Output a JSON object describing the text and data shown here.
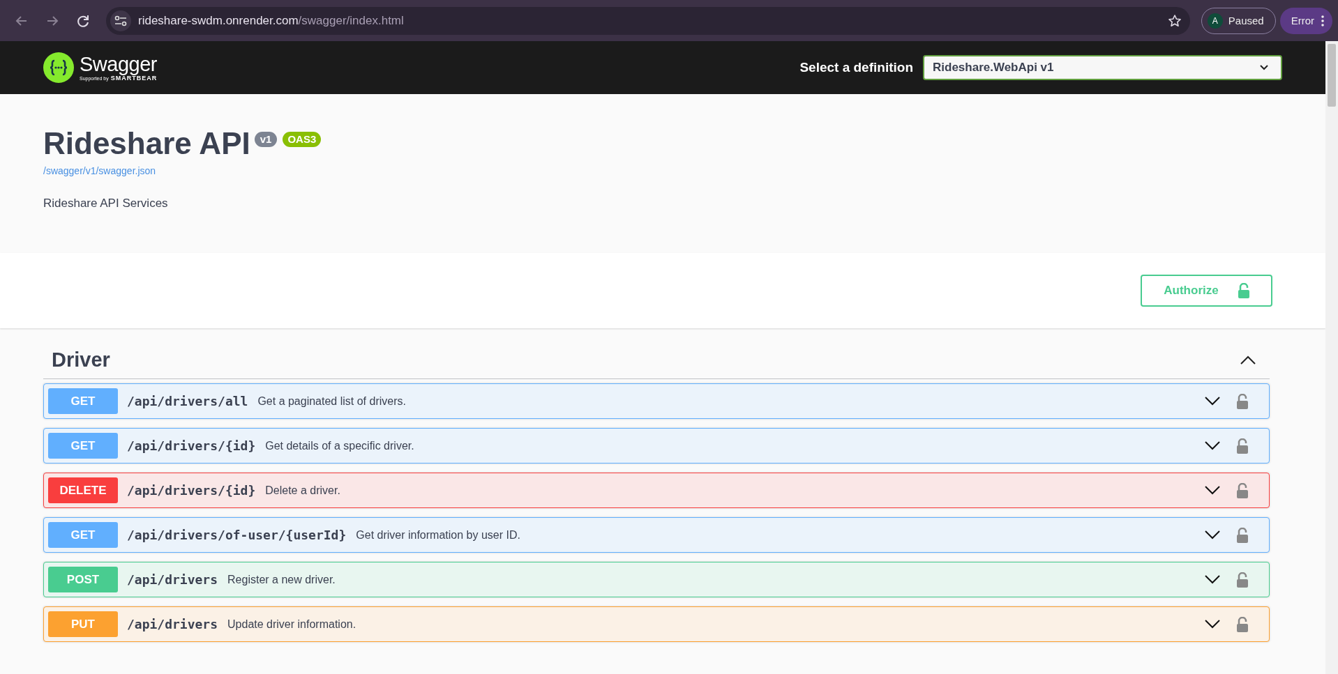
{
  "browser": {
    "url_host": "rideshare-swdm.onrender.com",
    "url_path": "/swagger/index.html",
    "profile": {
      "initial": "A",
      "label": "Paused"
    },
    "error_button": "Error"
  },
  "topbar": {
    "logo_text": "Swagger",
    "logo_sub_prefix": "Supported by",
    "logo_sub_brand": "SMARTBEAR",
    "select_label": "Select a definition",
    "select_value": "Rideshare.WebApi v1"
  },
  "info": {
    "title": "Rideshare API",
    "version": "v1",
    "oas": "OAS3",
    "spec_link": "/swagger/v1/swagger.json",
    "description": "Rideshare API Services"
  },
  "authorize": {
    "label": "Authorize"
  },
  "tags": [
    {
      "name": "Driver",
      "expanded": true,
      "operations": [
        {
          "method": "GET",
          "path": "/api/drivers/all",
          "summary": "Get a paginated list of drivers.",
          "expanded": false
        },
        {
          "method": "GET",
          "path": "/api/drivers/{id}",
          "summary": "Get details of a specific driver.",
          "expanded": false
        },
        {
          "method": "DELETE",
          "path": "/api/drivers/{id}",
          "summary": "Delete a driver.",
          "expanded": false
        },
        {
          "method": "GET",
          "path": "/api/drivers/of-user/{userId}",
          "summary": "Get driver information by user ID.",
          "expanded": false
        },
        {
          "method": "POST",
          "path": "/api/drivers",
          "summary": "Register a new driver.",
          "expanded": false
        },
        {
          "method": "PUT",
          "path": "/api/drivers",
          "summary": "Update driver information.",
          "expanded": false
        }
      ]
    }
  ]
}
